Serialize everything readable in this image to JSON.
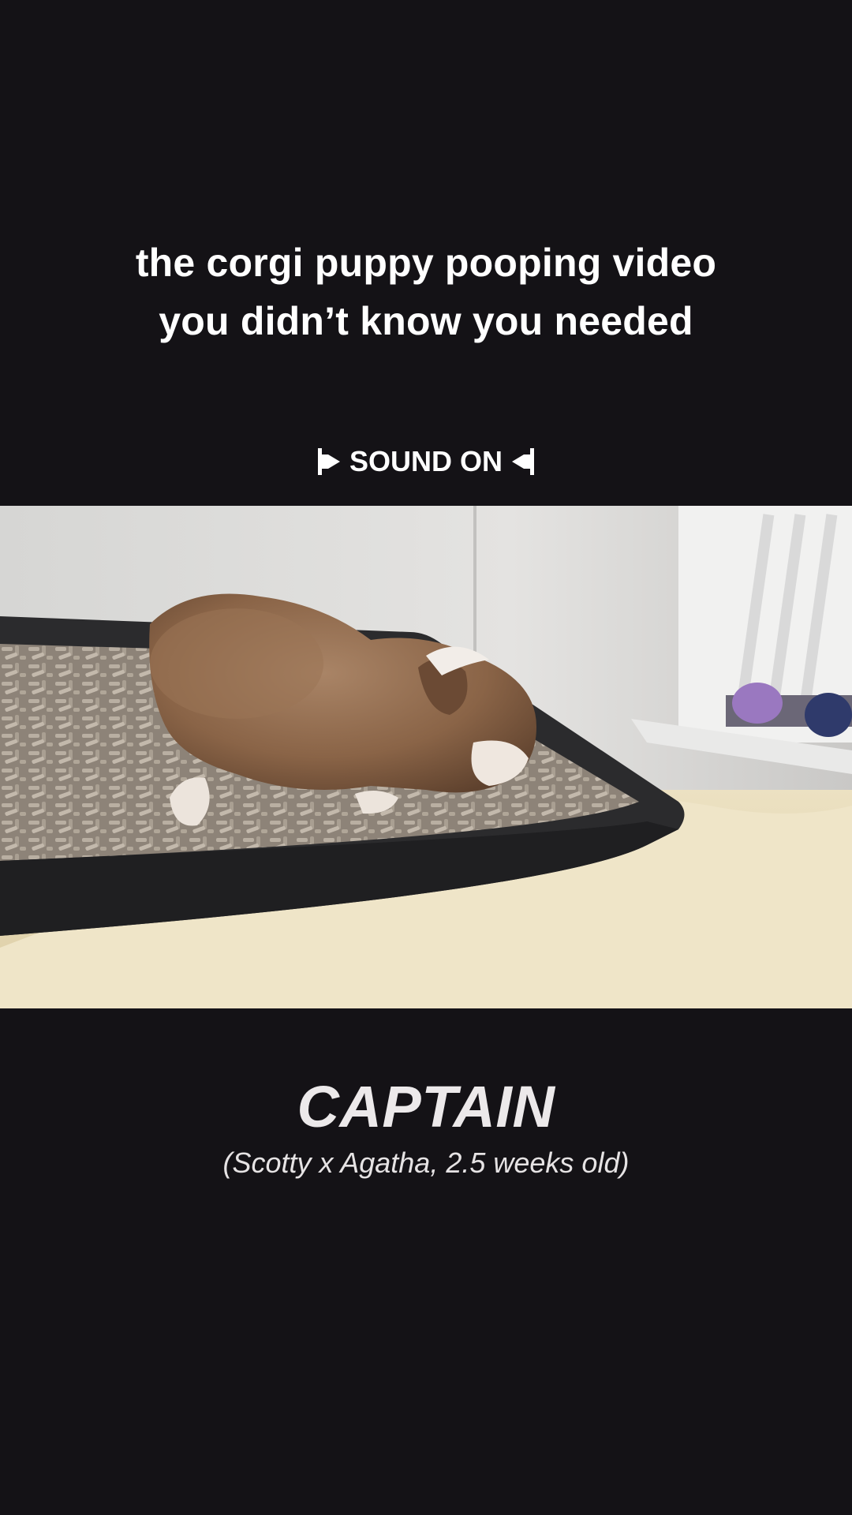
{
  "headline": {
    "line1": "the corgi puppy pooping video",
    "line2": "you didn’t know you needed"
  },
  "sound_banner": {
    "label": "SOUND ON",
    "left_icon": "speaker-icon",
    "right_icon": "speaker-icon"
  },
  "photo": {
    "subject": "corgi-puppy-in-litter-tray"
  },
  "caption": {
    "name": "CAPTAIN",
    "details": "(Scotty x Agatha, 2.5 weeks old)"
  },
  "colors": {
    "background": "#141216",
    "text": "#ffffff"
  }
}
